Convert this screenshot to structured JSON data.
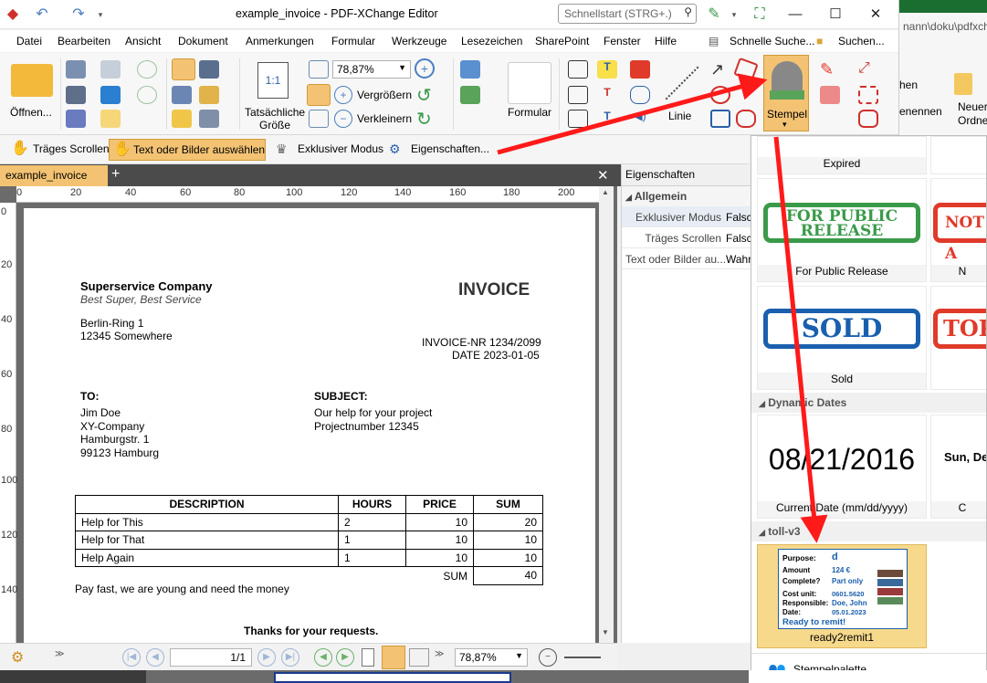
{
  "window": {
    "title": "example_invoice - PDF-XChange Editor",
    "quick_search_placeholder": "Schnellstart (STRG+.)"
  },
  "menu": [
    "Datei",
    "Bearbeiten",
    "Ansicht",
    "Dokument",
    "Anmerkungen",
    "Formular",
    "Werkzeuge",
    "Lesezeichen",
    "SharePoint",
    "Fenster",
    "Hilfe"
  ],
  "menu_right": {
    "quick_find": "Schnelle Suche...",
    "search": "Suchen..."
  },
  "ribbon": {
    "open": "Öffnen...",
    "actual_size": "Tatsächliche",
    "actual_size_2": "Größe",
    "zoom": "78,87%",
    "zoom_in": "Vergrößern",
    "zoom_out": "Verkleinern",
    "form": "Formular",
    "line": "Linie",
    "stamp": "Stempel"
  },
  "toolbar2": {
    "lazy_scroll": "Träges Scrollen",
    "select_text": "Text oder Bilder auswählen",
    "exclusive": "Exklusiver Modus",
    "properties": "Eigenschaften..."
  },
  "tab": {
    "label": "example_invoice",
    "add": "+",
    "close": "✕"
  },
  "rulers": {
    "h": [
      "0",
      "20",
      "40",
      "60",
      "80",
      "100",
      "120",
      "140",
      "160",
      "180",
      "200"
    ],
    "v": [
      "0",
      "20",
      "40",
      "60",
      "80",
      "100",
      "120",
      "140"
    ]
  },
  "invoice": {
    "company": "Superservice Company",
    "tagline": "Best Super, Best Service",
    "heading": "INVOICE",
    "address1": "Berlin-Ring 1",
    "address2": "12345 Somewhere",
    "number": "INVOICE-NR 1234/2099",
    "date": "DATE 2023-01-05",
    "to_label": "TO:",
    "to_lines": [
      "Jim Doe",
      "XY-Company",
      "Hamburgstr. 1",
      "99123 Hamburg"
    ],
    "subject_label": "SUBJECT:",
    "subject_lines": [
      "Our help for your project",
      "Projectnumber 12345"
    ],
    "columns": [
      "DESCRIPTION",
      "HOURS",
      "PRICE",
      "SUM"
    ],
    "rows": [
      [
        "Help for This",
        "2",
        "10",
        "20"
      ],
      [
        "Help for That",
        "1",
        "10",
        "10"
      ],
      [
        "Help Again",
        "1",
        "10",
        "10"
      ]
    ],
    "sum_label": "SUM",
    "sum_value": "40",
    "note": "Pay fast, we are young and need the money",
    "thanks": "Thanks for your requests."
  },
  "statusbar": {
    "page": "1/1",
    "zoom": "78,87%"
  },
  "properties": {
    "header": "Eigenschaften",
    "group": "Allgemein",
    "rows": [
      {
        "key": "Exklusiver Modus",
        "value": "Falsch"
      },
      {
        "key": "Träges Scrollen",
        "value": "Falsch"
      },
      {
        "key": "Text oder Bilder au...",
        "value": "Wahr"
      }
    ]
  },
  "background_window": {
    "path_text": "nann\\doku\\pdfxch",
    "item1": "hen",
    "item2": "enennen",
    "item3": "Neuer",
    "item4": "Ordne"
  },
  "stamp_panel": {
    "expired": "Expired",
    "public_release_text_1": "FOR PUBLIC",
    "public_release_text_2": "RELEASE",
    "public_release": "For Public Release",
    "not_text": "NOT A",
    "not_caption": "N",
    "sold_text": "SOLD",
    "sold": "Sold",
    "top_text": "TOP",
    "section_dynamic": "Dynamic Dates",
    "date_value": "08/21/2016",
    "date_caption": "Current Date (mm/dd/yyyy)",
    "date2_value": "Sun, De",
    "date2_caption": "C",
    "section_custom": "toll-v3",
    "custom_stamp": {
      "purpose_label": "Purpose:",
      "purpose_value": "d",
      "amount_label": "Amount",
      "amount_value": "124 €",
      "complete_label": "Complete?",
      "complete_value": "Part only",
      "cost_label": "Cost unit:",
      "cost_value": "0601.5620",
      "resp_label": "Responsible:",
      "resp_value": "Doe, John",
      "date_label": "Date:",
      "date_value": "05.01.2023",
      "footer": "Ready to remit!"
    },
    "custom_caption": "ready2remit1",
    "palette": "Stempelpalette"
  },
  "colors": {
    "accent_orange": "#f3c373",
    "arrow_red": "#ff1a1a",
    "stamp_green": "#3a9a4a",
    "stamp_red": "#e03a2a",
    "stamp_blue": "#1a5fae"
  }
}
